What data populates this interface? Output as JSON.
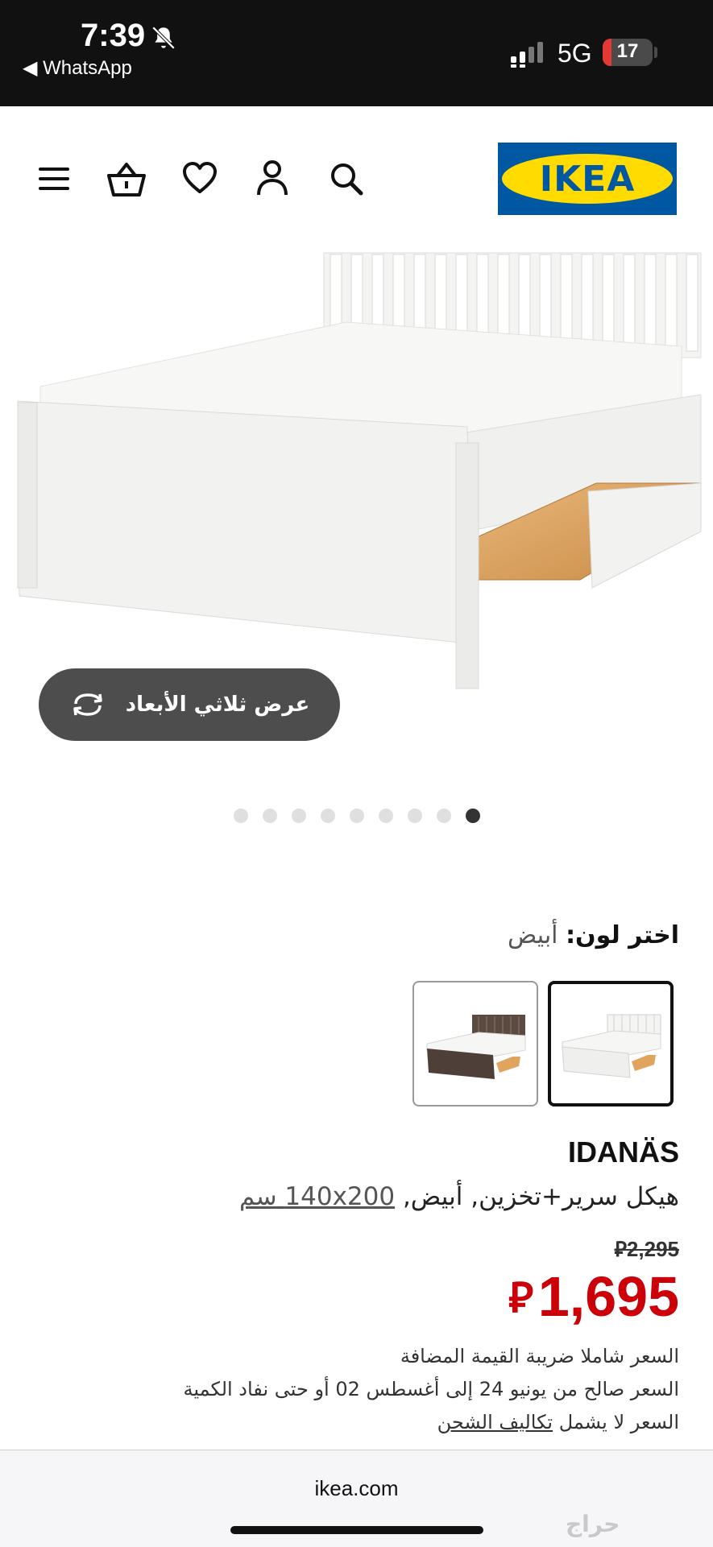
{
  "status_bar": {
    "time": "7:39",
    "back_app": "◀ WhatsApp",
    "network": "5G",
    "battery": "17",
    "battery_level": 0.17
  },
  "header": {
    "logo_text": "IKEA",
    "icons": [
      "menu-icon",
      "basket-icon",
      "heart-icon",
      "account-icon",
      "search-icon"
    ]
  },
  "gallery": {
    "view_3d_label": "عرض ثلاثي الأبعاد",
    "image_count": 9,
    "active_index": 8
  },
  "color_picker": {
    "label": "اختر لون:",
    "selected_value": "أبيض"
  },
  "product": {
    "name": "IDANÄS",
    "description": "هيكل سرير+تخزين, أبيض,",
    "size": "140x200 سم",
    "old_price": "2,295",
    "new_price": "1,695",
    "currency_symbol": "⃁"
  },
  "notes": {
    "vat": "السعر شاملا ضريبة القيمة المضافة",
    "validity": "السعر صالح من يونيو 24 إلى أغسطس 02 أو حتى نفاد الكمية",
    "shipping_prefix": "السعر لا يشمل",
    "shipping_link": "تكاليف الشحن"
  },
  "browser": {
    "url": "ikea.com"
  },
  "watermark": "حراج",
  "colors": {
    "ikea_blue": "#0058a3",
    "ikea_yellow": "#ffdb00",
    "price_red": "#cc0008"
  }
}
